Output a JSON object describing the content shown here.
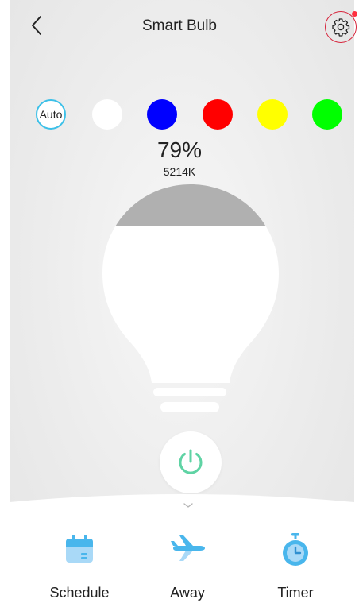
{
  "header": {
    "title": "Smart Bulb",
    "back_icon": "chevron-left-icon",
    "settings_icon": "gear-icon",
    "has_notification": true
  },
  "colors": {
    "auto_label": "Auto",
    "swatches": [
      {
        "name": "white",
        "hex": "#ffffff"
      },
      {
        "name": "blue",
        "hex": "#0000ff"
      },
      {
        "name": "red",
        "hex": "#ff0000"
      },
      {
        "name": "yellow",
        "hex": "#ffff00"
      },
      {
        "name": "green",
        "hex": "#00ff00"
      }
    ],
    "accent": "#3cc0e8"
  },
  "light": {
    "brightness": "79%",
    "brightness_value": 79,
    "color_temperature": "5214K",
    "bulb_fill": "#ffffff",
    "bulb_dim_fill": "#b0b0b0",
    "power_on": true,
    "power_color": "#5fd3a4"
  },
  "actions": [
    {
      "label": "Schedule",
      "icon": "calendar-icon"
    },
    {
      "label": "Away",
      "icon": "airplane-icon"
    },
    {
      "label": "Timer",
      "icon": "stopwatch-icon"
    }
  ],
  "icon_color": "#49b6ec"
}
